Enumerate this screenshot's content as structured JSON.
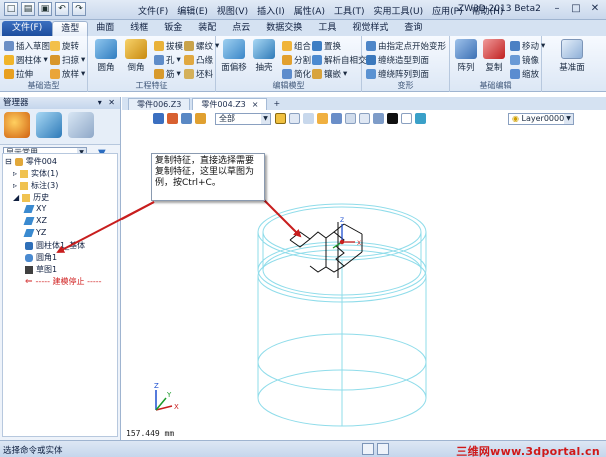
{
  "titlebar": {
    "menus": [
      "文件(F)",
      "编辑(E)",
      "视图(V)",
      "插入(I)",
      "属性(A)",
      "工具(T)",
      "实用工具(U)",
      "应用(P)",
      "帮助(H)"
    ],
    "app_title": "ZW3D 2013 Beta2",
    "quick_access": [
      "new-icon",
      "open-icon",
      "save-icon",
      "undo-icon",
      "redo-icon"
    ]
  },
  "ribbon_tabs": [
    "文件(F)",
    "造型",
    "曲面",
    "线框",
    "钣金",
    "装配",
    "点云",
    "数据交换",
    "工具",
    "视觉样式",
    "查询"
  ],
  "active_tab": "造型",
  "ribbon": {
    "groups": [
      {
        "label": "基础造型",
        "items": [
          "插入草图",
          "圆柱体",
          "拉伸",
          "旋转",
          "扫掠",
          "放样"
        ]
      },
      {
        "label": "工程特征",
        "items": [
          "圆角",
          "倒角",
          "拔模",
          "孔",
          "筋",
          "螺纹",
          "凸缘",
          "坯料"
        ]
      },
      {
        "label": "编辑模型",
        "items": [
          "面偏移",
          "抽壳",
          "组合",
          "分割",
          "简化",
          "置换",
          "解析自相交",
          "镶嵌"
        ]
      },
      {
        "label": "变形",
        "items": [
          "由指定点开始变形",
          "缠绕造型到面",
          "缠绕阵列到面"
        ]
      },
      {
        "label": "基础编辑",
        "items": [
          "阵列",
          "复制",
          "移动",
          "镜像",
          "缩放"
        ]
      },
      {
        "label": "",
        "items": [
          "基准面"
        ]
      }
    ]
  },
  "panel": {
    "title": "管理器",
    "filter_value": "显示常用",
    "tree": [
      {
        "label": "零件004",
        "level": 0,
        "icon": "part-icon"
      },
      {
        "label": "实体(1)",
        "level": 1,
        "icon": "folder-icon"
      },
      {
        "label": "标注(3)",
        "level": 1,
        "icon": "folder-icon"
      },
      {
        "label": "历史",
        "level": 1,
        "icon": "folder-icon"
      },
      {
        "label": "XY",
        "level": 2,
        "icon": "plane-icon"
      },
      {
        "label": "XZ",
        "level": 2,
        "icon": "plane-icon"
      },
      {
        "label": "YZ",
        "level": 2,
        "icon": "plane-icon"
      },
      {
        "label": "圆柱体1_基体",
        "level": 2,
        "icon": "cylinder-icon"
      },
      {
        "label": "圆角1",
        "level": 2,
        "icon": "fillet-icon"
      },
      {
        "label": "草图1",
        "level": 2,
        "icon": "sketch-icon"
      },
      {
        "label": "----- 建模停止 -----",
        "level": 2,
        "icon": "stop-arrow-icon"
      }
    ]
  },
  "doc_tabs": [
    {
      "label": "零件006.Z3",
      "active": false
    },
    {
      "label": "零件004.Z3",
      "active": true,
      "close": "×"
    }
  ],
  "doc_tabs_add": "+",
  "viewport_toolbar": {
    "filter_value": "全部",
    "layer_value": "Layer0000"
  },
  "callout_text": "复制特征，直接选择需要复制特征，这里以草图为例，按Ctrl+C。",
  "triad_labels": {
    "x": "X",
    "y": "Y",
    "z": "Z"
  },
  "coord_readout": "157.449 mm",
  "status_text": "选择命令或实体",
  "watermark": "三维网www.3dportal.cn",
  "colors": {
    "wireframe": "#8fdcea",
    "sketch": "#000000",
    "arrow": "#c81e1e",
    "accent": "#1d4e9e"
  }
}
